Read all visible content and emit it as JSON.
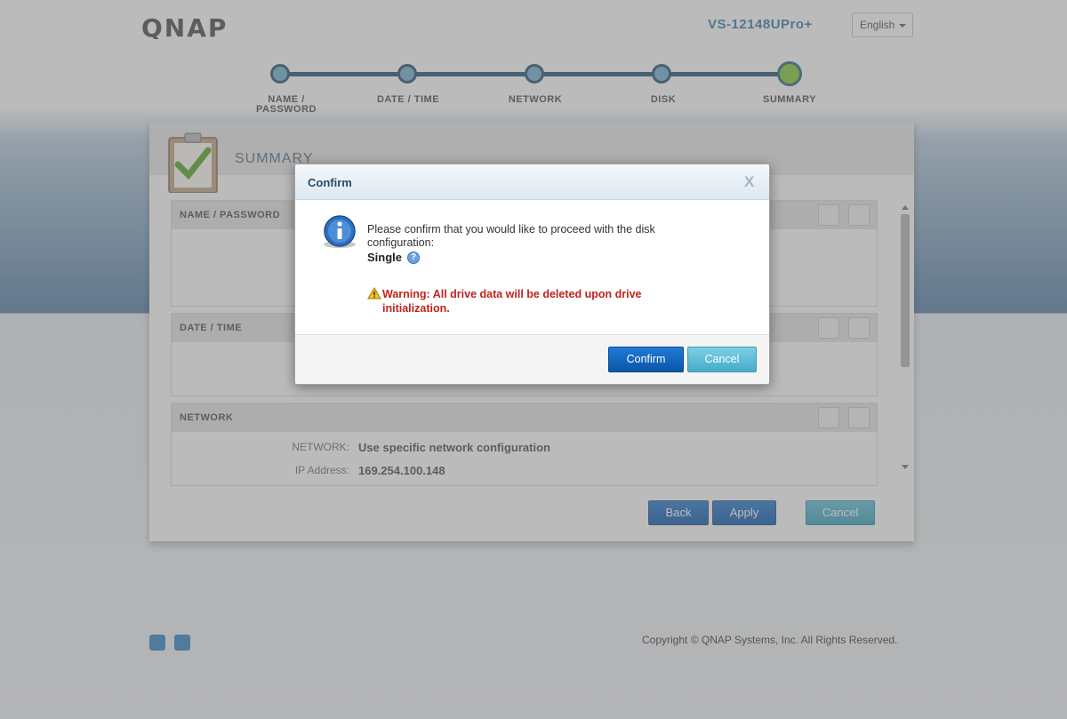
{
  "header": {
    "logo_text": "QNAP",
    "model": "VS-12148UPro+",
    "language": "English"
  },
  "stepper": {
    "steps": [
      "NAME /\nPASSWORD",
      "DATE / TIME",
      "NETWORK",
      "DISK",
      "SUMMARY"
    ],
    "active_step": "SUMMARY"
  },
  "wizard": {
    "title": "SUMMARY",
    "sections": [
      {
        "title": "NAME / PASSWORD"
      },
      {
        "title": "DATE / TIME"
      },
      {
        "title": "NETWORK",
        "fields": [
          {
            "label": "NETWORK:",
            "value": "Use specific network configuration"
          },
          {
            "label": "IP Address:",
            "value": "169.254.100.148"
          }
        ]
      }
    ],
    "buttons": {
      "back": "Back",
      "apply": "Apply",
      "cancel": "Cancel"
    }
  },
  "footer": {
    "copyright": "Copyright © QNAP Systems, Inc. All Rights Reserved."
  },
  "dialog": {
    "title": "Confirm",
    "close_label": "X",
    "message": "Please confirm that you would like to proceed with the disk configuration:",
    "configuration": "Single",
    "help_label": "?",
    "warning": "Warning: All drive data will be deleted upon drive initialization.",
    "confirm_label": "Confirm",
    "cancel_label": "Cancel"
  },
  "colors": {
    "accent": "#1f7ad6",
    "warning": "#c0231e",
    "active_step": "#8dcb3f"
  }
}
